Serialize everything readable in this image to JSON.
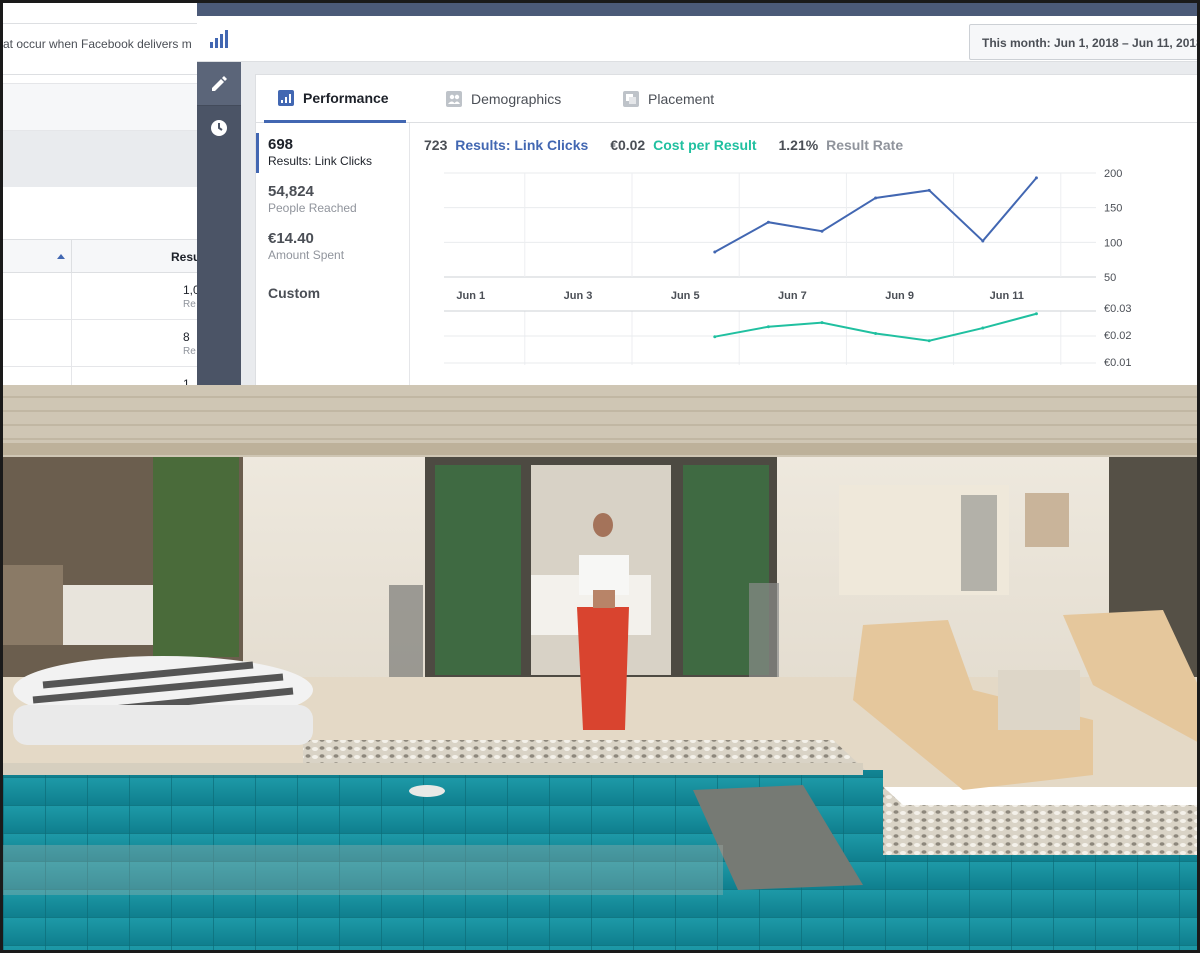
{
  "background_table": {
    "description": "at occur when Facebook delivers m",
    "column_header": "Resul",
    "rows": [
      {
        "value": "1,0",
        "sub": "Re"
      },
      {
        "value": "8",
        "sub": "Re"
      },
      {
        "value": "1",
        "sub": ""
      }
    ]
  },
  "header": {
    "date_range": "This month: Jun 1, 2018 – Jun 11, 2018"
  },
  "tabs": [
    {
      "label": "Performance",
      "icon": "bar-chart-icon"
    },
    {
      "label": "Demographics",
      "icon": "people-icon"
    },
    {
      "label": "Placement",
      "icon": "placement-icon"
    }
  ],
  "stats": {
    "results": {
      "value": "698",
      "label": "Results: Link Clicks"
    },
    "reach": {
      "value": "54,824",
      "label": "People Reached"
    },
    "spent": {
      "value": "€14.40",
      "label": "Amount Spent"
    },
    "custom": "Custom"
  },
  "metrics": {
    "results_num": "723",
    "results_label": "Results: Link Clicks",
    "cost_num": "€0.02",
    "cost_label": "Cost per Result",
    "rate_num": "1.21%",
    "rate_label": "Result Rate"
  },
  "colors": {
    "blue": "#4267b2",
    "green": "#20c0a0",
    "rail": "#4b5466"
  },
  "chart_data": [
    {
      "type": "line",
      "x": [
        "Jun 6",
        "Jun 7",
        "Jun 8",
        "Jun 9",
        "Jun 10",
        "Jun 11",
        "Jun 12"
      ],
      "tick_labels": [
        "Jun 1",
        "Jun 3",
        "Jun 5",
        "Jun 7",
        "Jun 9",
        "Jun 11"
      ],
      "series": [
        {
          "name": "Results: Link Clicks",
          "values": [
            86,
            129,
            116,
            164,
            175,
            102,
            193
          ]
        }
      ],
      "y_ticks": [
        "200",
        "150",
        "100",
        "50"
      ],
      "ylim": [
        50,
        200
      ]
    },
    {
      "type": "line",
      "x": [
        "Jun 6",
        "Jun 7",
        "Jun 8",
        "Jun 9",
        "Jun 10",
        "Jun 11",
        "Jun 12"
      ],
      "series": [
        {
          "name": "Cost per Result",
          "values": [
            0.019,
            0.0227,
            0.0242,
            0.0202,
            0.0175,
            0.0222,
            0.0275
          ]
        }
      ],
      "y_ticks": [
        "€0.03",
        "€0.02",
        "€0.01"
      ],
      "ylim": [
        0.01,
        0.03
      ]
    }
  ]
}
